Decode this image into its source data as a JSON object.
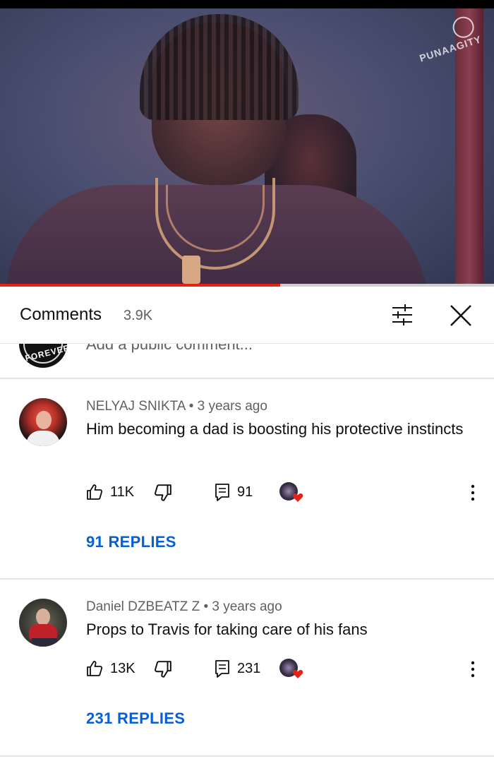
{
  "video": {
    "watermark": "PUNAAGITY",
    "progress_fraction": 0.567
  },
  "comments_panel": {
    "title": "Comments",
    "count": "3.9K",
    "filter_icon": "sort-filter-icon",
    "close_icon": "close-icon"
  },
  "add_comment": {
    "placeholder": "Add a public comment...",
    "avatar_text": "FOREVER"
  },
  "comments": [
    {
      "author": "NELYAJ SNIKTA",
      "time": "3 years ago",
      "meta": "NELYAJ SNIKTA • 3 years ago",
      "text": "Him becoming a dad is boosting his protective instincts",
      "likes": "11K",
      "reply_count": "91",
      "replies_label": "91 REPLIES",
      "creator_hearted": true
    },
    {
      "author": "Daniel DZBEATZ Z",
      "time": "3 years ago",
      "meta": "Daniel DZBEATZ Z • 3 years ago",
      "text": "Props to Travis for taking care of his fans",
      "likes": "13K",
      "reply_count": "231",
      "replies_label": "231 REPLIES",
      "creator_hearted": true
    }
  ],
  "colors": {
    "link_blue": "#065fd4",
    "progress_red": "#e62117",
    "heart_red": "#e62117",
    "secondary_text": "#606060"
  }
}
